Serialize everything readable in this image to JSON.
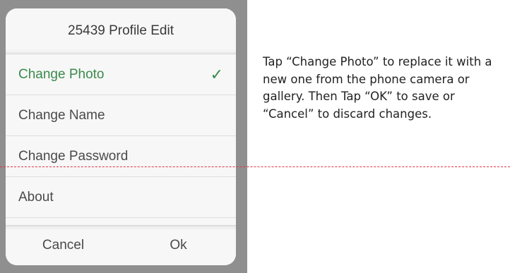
{
  "dialog": {
    "title": "25439 Profile Edit",
    "options": [
      {
        "label": "Change Photo",
        "selected": true
      },
      {
        "label": "Change Name",
        "selected": false
      },
      {
        "label": "Change Password",
        "selected": false
      },
      {
        "label": "About",
        "selected": false
      }
    ],
    "checkmark_glyph": "✓",
    "cancel_label": "Cancel",
    "ok_label": "Ok"
  },
  "instruction_text": "Tap “Change Photo” to replace it with a new one from the phone camera or gallery. Then Tap “OK” to save or “Cancel” to discard changes.",
  "colors": {
    "accent": "#3a8a4c",
    "backdrop": "#8f8f8f",
    "guide_line": "#e0334a"
  }
}
